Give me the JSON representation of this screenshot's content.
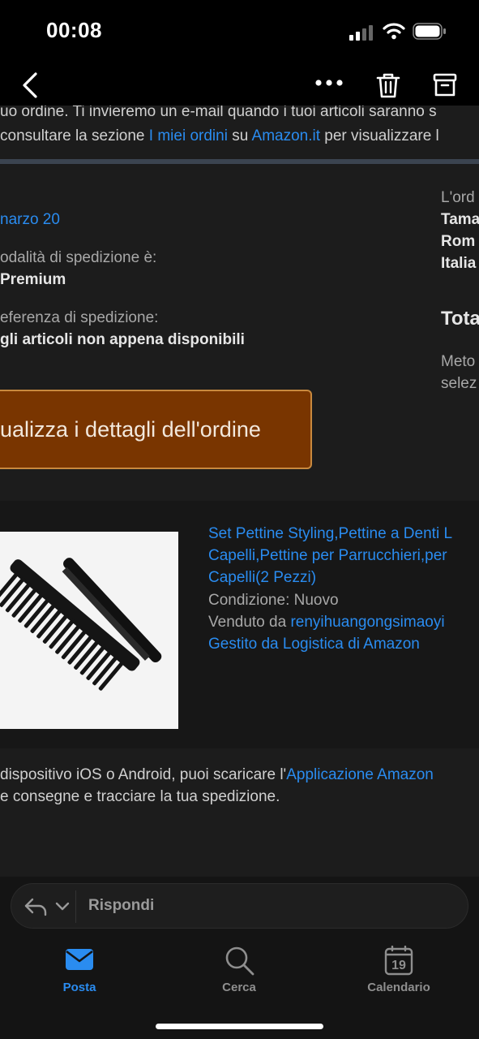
{
  "status_bar": {
    "time": "00:08"
  },
  "email": {
    "intro_line1": "uo ordine. Ti invieremo un e-mail quando i tuoi articoli saranno s",
    "intro_line2_a": "consultare la sezione ",
    "intro_line2_link1": "I miei ordini",
    "intro_line2_b": " su ",
    "intro_line2_link2": "Amazon.it",
    "intro_line2_c": " per visualizzare l",
    "delivery_date": "narzo 20",
    "shipping_method_label": "odalità di spedizione è:",
    "shipping_method_value": "Premium",
    "shipping_pref_label": "eferenza di spedizione:",
    "shipping_pref_value": "gli articoli non appena disponibili",
    "right_col": {
      "order_label": "L'ord",
      "addr1": "Tama",
      "addr2": "Rom",
      "addr3": "Italia",
      "total_label": "Tota",
      "payment1": "Meto",
      "payment2": "selez"
    },
    "order_button": "ualizza i dettagli dell'ordine",
    "product": {
      "title_line1": "Set Pettine Styling,Pettine a Denti L",
      "title_line2": "Capelli,Pettine per Parrucchieri,per",
      "title_line3": "Capelli(2 Pezzi)",
      "condition": "Condizione: Nuovo",
      "sold_by_label": "Venduto da ",
      "sold_by_value": "renyihuangongsimaoyi",
      "fulfilled": "Gestito da Logistica di Amazon"
    },
    "app_line1_a": "dispositivo iOS o Android, puoi scaricare l'",
    "app_line1_link": "Applicazione Amazon",
    "app_line2": "e consegne e tracciare la tua spedizione."
  },
  "reply": {
    "label": "Rispondi"
  },
  "tabs": [
    {
      "label": "Posta",
      "icon": "mail-icon",
      "active": true
    },
    {
      "label": "Cerca",
      "icon": "search-icon",
      "active": false
    },
    {
      "label": "Calendario",
      "icon": "calendar-icon",
      "active": false,
      "day": "19"
    }
  ],
  "colors": {
    "accent": "#2a8cf0",
    "button": "#793500",
    "background": "#1c1c1c"
  }
}
